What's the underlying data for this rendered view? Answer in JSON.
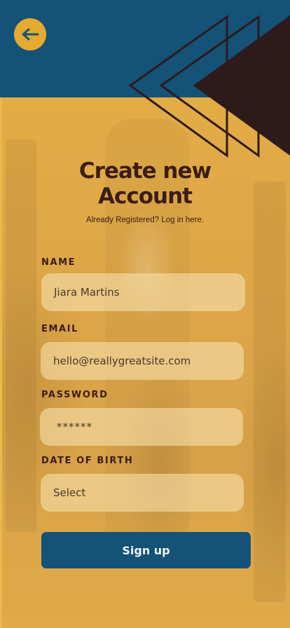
{
  "header": {
    "back_icon": "arrow-left-icon"
  },
  "colors": {
    "header_blue": "#145277",
    "mustard": "#e4ab2f",
    "dark_brown": "#3b1c16",
    "button_blue": "#145277"
  },
  "form": {
    "title_line1": "Create new",
    "title_line2": "Account",
    "subtitle": "Already Registered? Log in here.",
    "name_label": "NAME",
    "name_value": "Jiara Martins",
    "email_label": "EMAIL",
    "email_value": "hello@reallygreatsite.com",
    "password_label": "PASSWORD",
    "password_value": "******",
    "dob_label": "DATE OF BIRTH",
    "dob_value": "Select",
    "signup_label": "Sign up"
  }
}
